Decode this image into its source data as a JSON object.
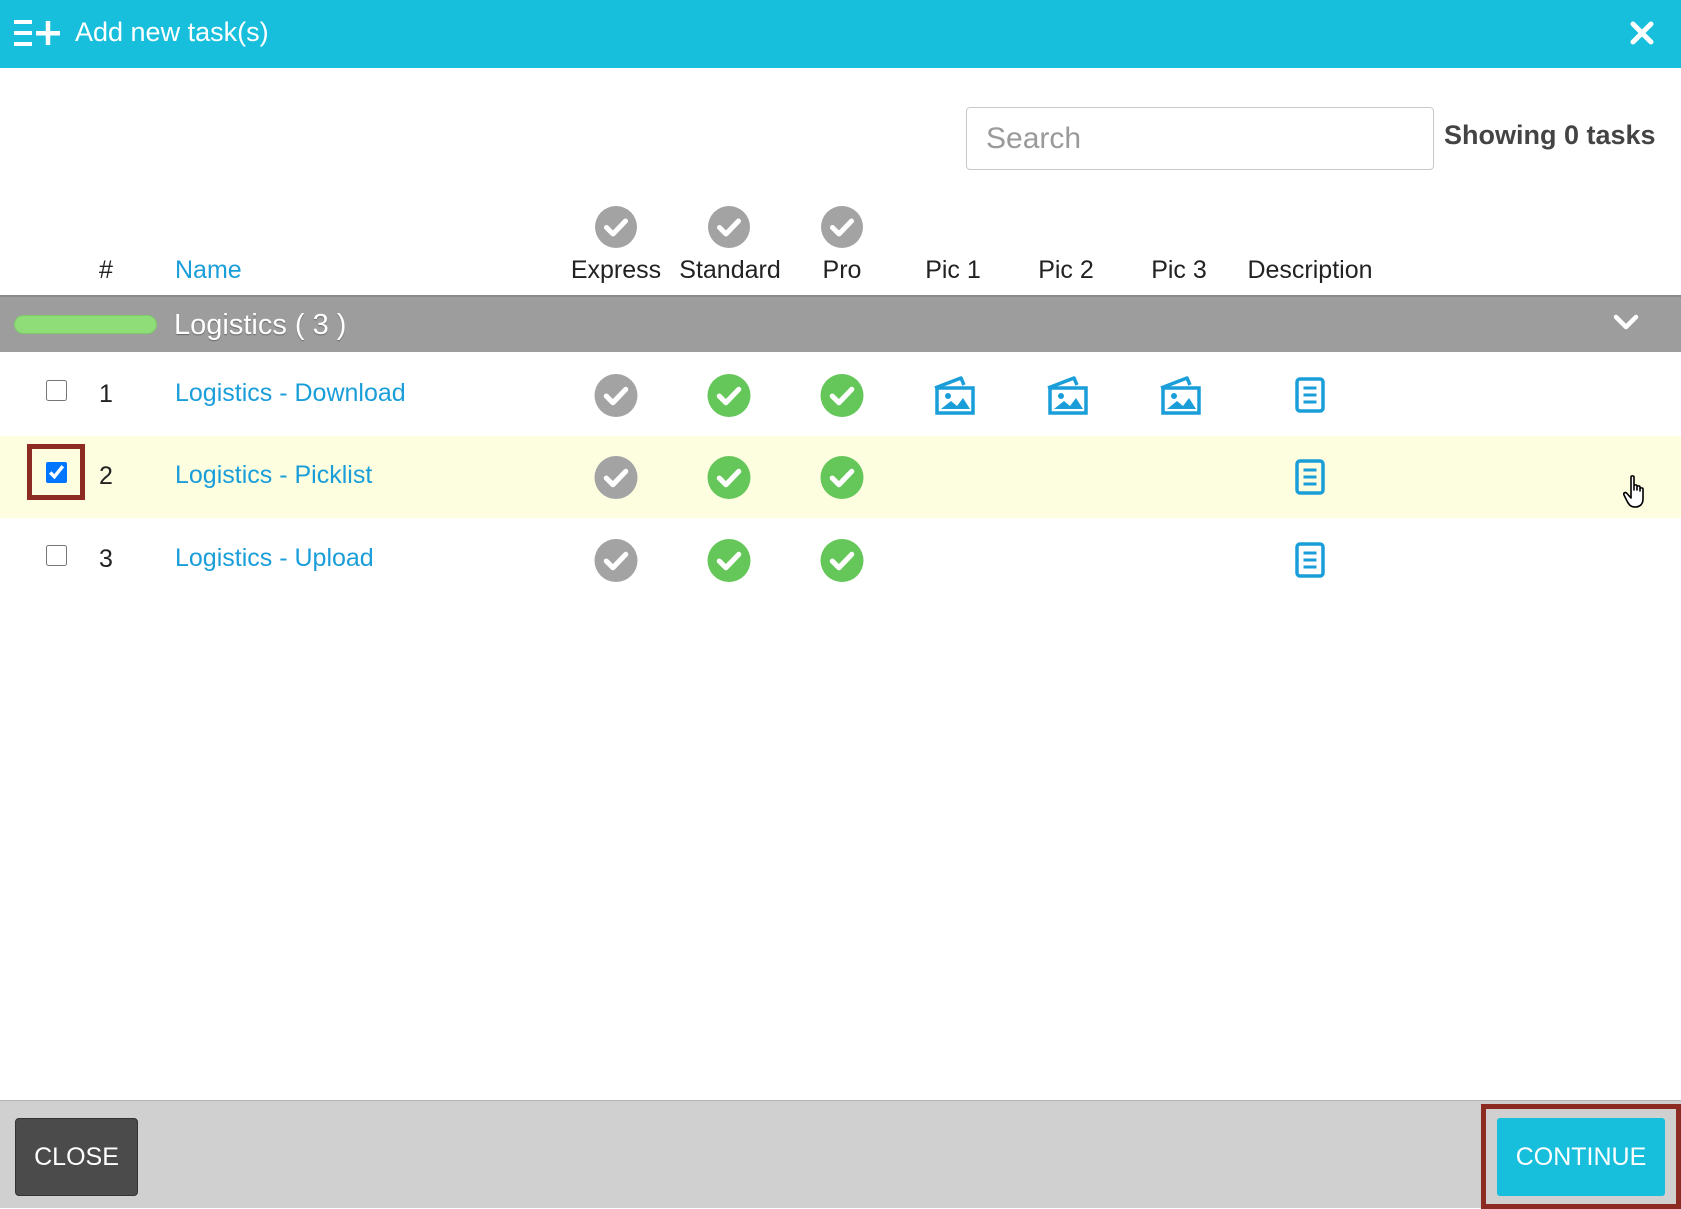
{
  "dialog": {
    "title": "Add new task(s)",
    "accent_color": "#17bfdc",
    "icons": {
      "add": "list-add-icon",
      "close": "close-icon"
    }
  },
  "search": {
    "placeholder": "Search",
    "value": ""
  },
  "status": {
    "showing_text": "Showing 0 tasks"
  },
  "columns": {
    "number": "#",
    "name": "Name",
    "express": "Express",
    "standard": "Standard",
    "pro": "Pro",
    "pic1": "Pic 1",
    "pic2": "Pic 2",
    "pic3": "Pic 3",
    "description": "Description"
  },
  "group": {
    "title": "Logistics ( 3 )",
    "pill_color": "#8fdd78",
    "expanded": true
  },
  "tasks": [
    {
      "number": "1",
      "name": "Logistics - Download",
      "checked": false,
      "express": "gray-check",
      "standard": "green-check",
      "pro": "green-check",
      "pic1": true,
      "pic2": true,
      "pic3": true,
      "description": true
    },
    {
      "number": "2",
      "name": "Logistics - Picklist",
      "checked": true,
      "express": "gray-check",
      "standard": "green-check",
      "pro": "green-check",
      "pic1": false,
      "pic2": false,
      "pic3": false,
      "description": true
    },
    {
      "number": "3",
      "name": "Logistics - Upload",
      "checked": false,
      "express": "gray-check",
      "standard": "green-check",
      "pro": "green-check",
      "pic1": false,
      "pic2": false,
      "pic3": false,
      "description": true
    }
  ],
  "footer": {
    "close_label": "CLOSE",
    "continue_label": "CONTINUE"
  },
  "colors": {
    "check_gray": "#a3a3a3",
    "check_green": "#65c75a",
    "link_blue": "#1a9ed9",
    "highlight_row": "#fdfde0",
    "annotation_red": "#8b2b22"
  }
}
